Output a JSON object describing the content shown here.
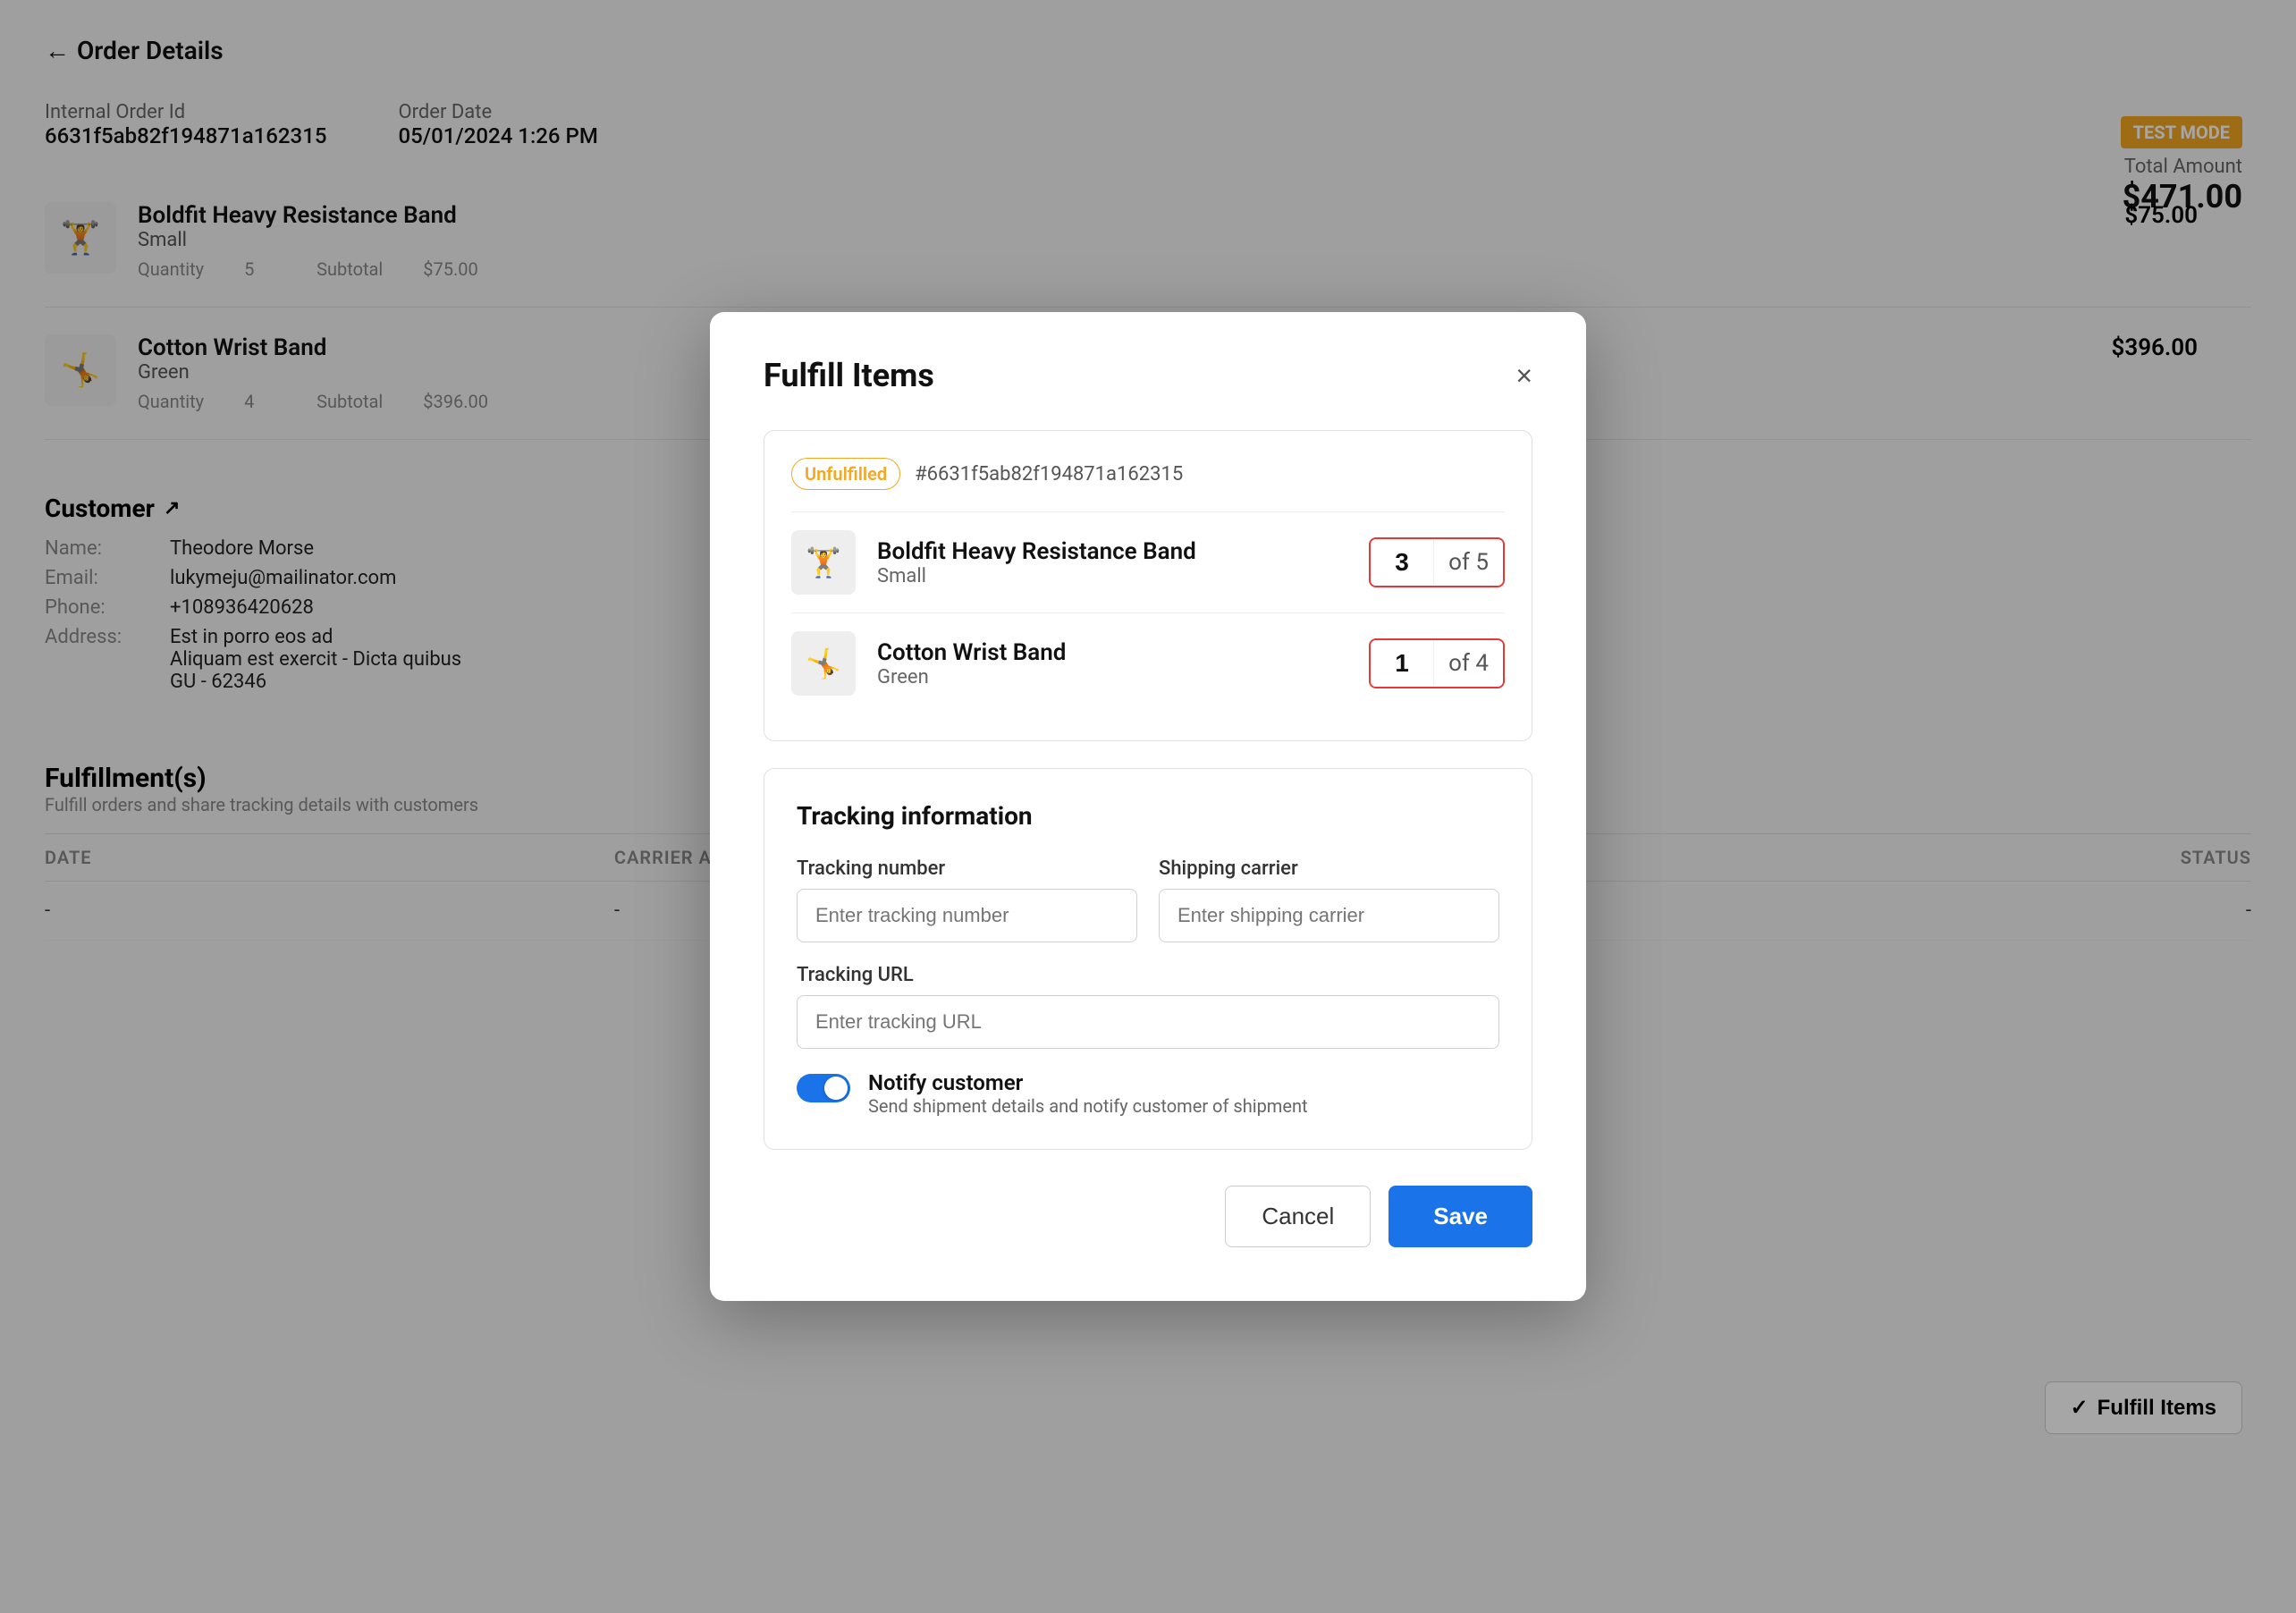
{
  "page": {
    "title": "Order Details",
    "back_label": "Order Details"
  },
  "order": {
    "internal_order_id_label": "Internal Order Id",
    "internal_order_id_value": "6631f5ab82f194871a162315",
    "order_date_label": "Order Date",
    "order_date_value": "05/01/2024 1:26 PM",
    "test_mode_badge": "TEST MODE",
    "total_amount_label": "Total Amount",
    "total_amount_value": "$471.00"
  },
  "products": [
    {
      "name": "Boldfit Heavy Resistance Band",
      "variant": "Small",
      "quantity_label": "Quantity",
      "quantity_value": "5",
      "subtotal_label": "Subtotal",
      "subtotal_value": "$75.00",
      "price": "$75.00"
    },
    {
      "name": "Cotton Wrist Band",
      "variant": "Green",
      "quantity_label": "Quantity",
      "quantity_value": "4",
      "subtotal_label": "Subtotal",
      "subtotal_value": "$396.00",
      "price": "$396.00"
    }
  ],
  "customer": {
    "section_title": "Customer",
    "name_label": "Name:",
    "name_value": "Theodore Morse",
    "email_label": "Email:",
    "email_value": "lukymeju@mailinator.com",
    "phone_label": "Phone:",
    "phone_value": "+108936420628",
    "address_label": "Address:",
    "address_line1": "Est in porro eos ad",
    "address_line2": "Aliquam est exercit - Dicta quibus",
    "address_line3": "GU - 62346"
  },
  "fulfillments": {
    "section_title": "Fulfillment(s)",
    "subtitle": "Fulfill orders and share tracking details with customers",
    "fulfill_items_btn": "Fulfill Items",
    "table_headers": [
      "DATE",
      "CARRIER AND TRACKING",
      "STATUS"
    ],
    "table_row_date": "-",
    "table_row_carrier": "-",
    "table_row_status": "-"
  },
  "modal": {
    "title": "Fulfill Items",
    "close_label": "×",
    "order_badge": "Unfulfilled",
    "order_id": "#6631f5ab82f194871a162315",
    "items": [
      {
        "name": "Boldfit Heavy Resistance Band",
        "variant": "Small",
        "qty_value": "3",
        "qty_of_text": "of 5"
      },
      {
        "name": "Cotton Wrist Band",
        "variant": "Green",
        "qty_value": "1",
        "qty_of_text": "of 4"
      }
    ],
    "tracking": {
      "section_title": "Tracking information",
      "tracking_number_label": "Tracking number",
      "tracking_number_placeholder": "Enter tracking number",
      "shipping_carrier_label": "Shipping carrier",
      "shipping_carrier_placeholder": "Enter shipping carrier",
      "tracking_url_label": "Tracking URL",
      "tracking_url_placeholder": "Enter tracking URL"
    },
    "notify": {
      "title": "Notify customer",
      "description": "Send shipment details and notify customer of shipment",
      "enabled": true
    },
    "cancel_label": "Cancel",
    "save_label": "Save"
  }
}
